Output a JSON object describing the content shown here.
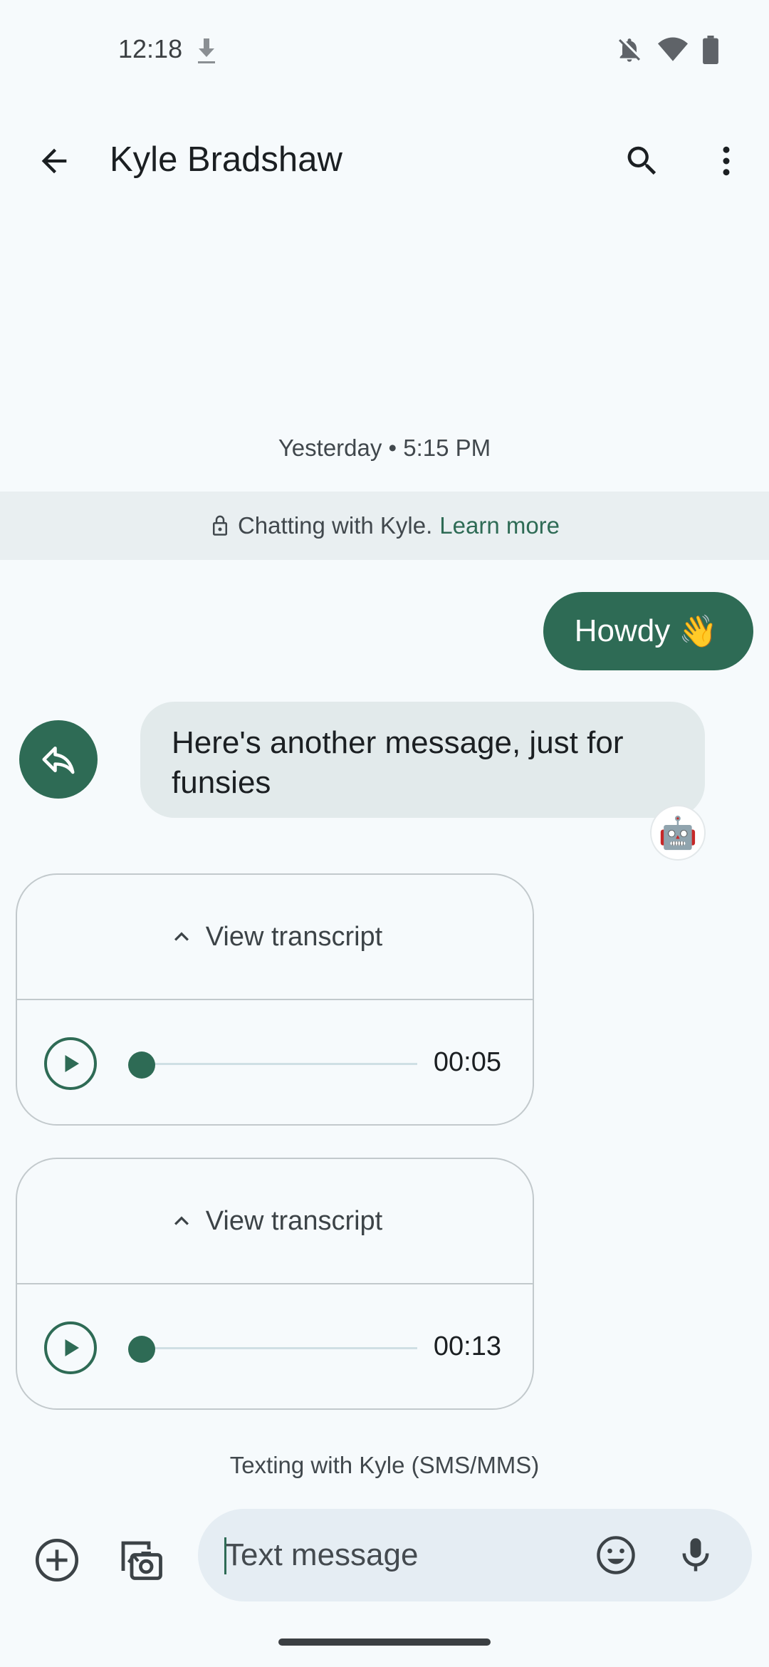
{
  "status_bar": {
    "time": "12:18",
    "icons": [
      "download-icon",
      "notifications-off-icon",
      "wifi-icon",
      "battery-icon"
    ]
  },
  "app_bar": {
    "title": "Kyle Bradshaw",
    "icons": [
      "back-arrow-icon",
      "search-icon",
      "more-vert-icon"
    ]
  },
  "conversation": {
    "timestamp": "Yesterday • 5:15 PM",
    "encryption_banner": {
      "text": "Chatting with Kyle.",
      "link": "Learn more"
    },
    "messages": [
      {
        "direction": "outgoing",
        "text": "Howdy",
        "emoji": "👋"
      },
      {
        "direction": "incoming",
        "text": "Here's another message, just for funsies",
        "reaction": "🤖"
      }
    ],
    "audio_messages": [
      {
        "transcript_label": "View transcript",
        "duration": "00:05",
        "progress": 0
      },
      {
        "transcript_label": "View transcript",
        "duration": "00:13",
        "progress": 0
      }
    ],
    "sms_label": "Texting with Kyle (SMS/MMS)"
  },
  "compose": {
    "placeholder": "Text message",
    "value": ""
  },
  "colors": {
    "accent": "#2e6b55",
    "background": "#f6fafc",
    "incoming_bubble": "#e2eaeb",
    "compose_bg": "#e5edf3"
  }
}
